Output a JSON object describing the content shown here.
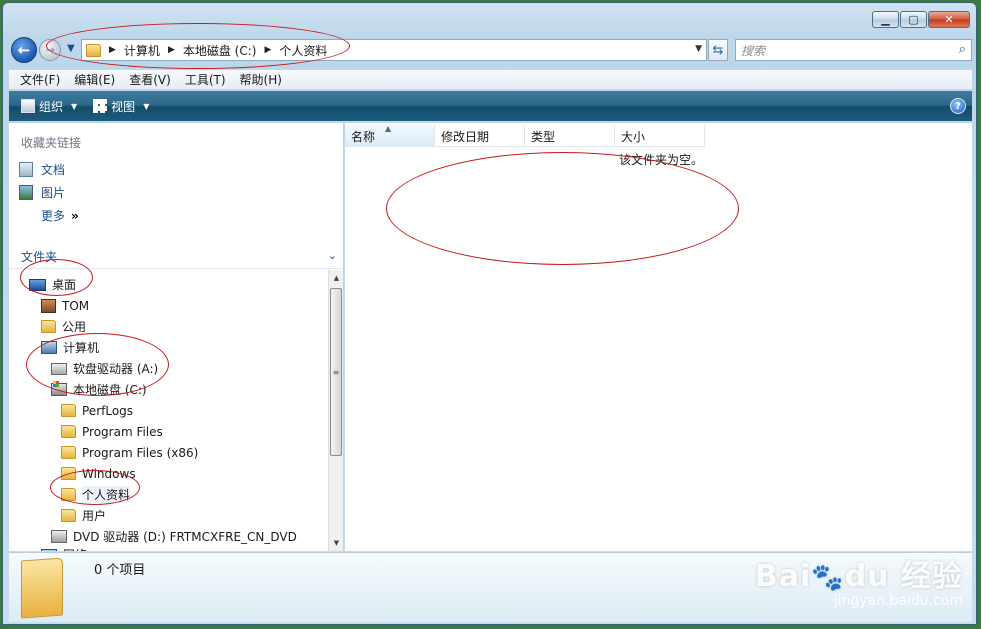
{
  "address": {
    "crumbs": [
      "计算机",
      "本地磁盘 (C:)",
      "个人资料"
    ]
  },
  "search": {
    "placeholder": "搜索"
  },
  "menu": [
    "文件(F)",
    "编辑(E)",
    "查看(V)",
    "工具(T)",
    "帮助(H)"
  ],
  "commands": {
    "organize": "组织",
    "views": "视图"
  },
  "favorites": {
    "header": "收藏夹链接",
    "items": [
      "文档",
      "图片"
    ],
    "more": "更多"
  },
  "folders": {
    "header": "文件夹",
    "tree": [
      "桌面",
      "TOM",
      "公用",
      "计算机",
      "软盘驱动器 (A:)",
      "本地磁盘 (C:)",
      "PerfLogs",
      "Program Files",
      "Program Files (x86)",
      "Windows",
      "个人资料",
      "用户",
      "DVD 驱动器 (D:) FRTMCXFRE_CN_DVD",
      "网络"
    ]
  },
  "columns": [
    "名称",
    "修改日期",
    "类型",
    "大小"
  ],
  "empty_message": "该文件夹为空。",
  "details": {
    "count": "0 个项目"
  },
  "watermark": {
    "logo": "Bai",
    "logo2": "du",
    "cn": "经验",
    "url": "jingyan.baidu.com"
  }
}
